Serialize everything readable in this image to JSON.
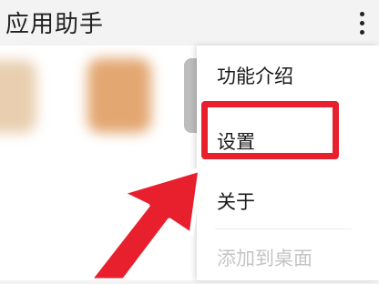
{
  "app": {
    "title": "应用助手"
  },
  "menu": {
    "items": [
      {
        "label": "功能介绍",
        "enabled": true
      },
      {
        "label": "设置",
        "enabled": true
      },
      {
        "label": "关于",
        "enabled": true
      },
      {
        "label": "添加到桌面",
        "enabled": false
      }
    ]
  },
  "colors": {
    "highlight": "#e8202e",
    "disabled_text": "#c4c4c4"
  },
  "icons": {
    "overflow": "more-vertical-icon"
  }
}
